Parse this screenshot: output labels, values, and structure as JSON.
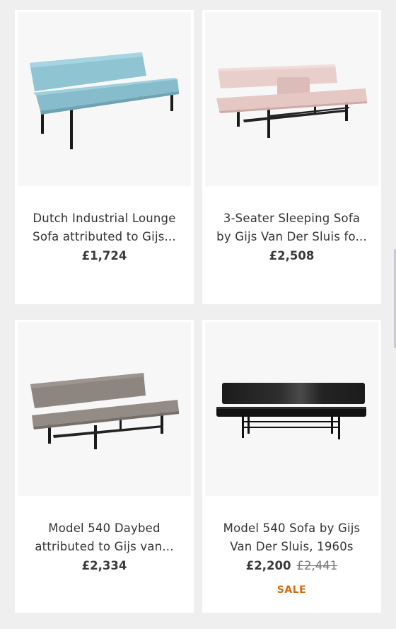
{
  "products": [
    {
      "title_line1": "Dutch Industrial Lounge",
      "title_line2": "Sofa attributed to Gijs...",
      "price": "£1,724",
      "image_icon": "blue-sofa-image"
    },
    {
      "title_line1": "3-Seater Sleeping Sofa",
      "title_line2": "by Gijs Van Der Sluis fo...",
      "price": "£2,508",
      "image_icon": "pink-sofa-image"
    },
    {
      "title_line1": "Model 540 Daybed",
      "title_line2": "attributed to Gijs van...",
      "price": "£2,334",
      "image_icon": "grey-daybed-image"
    },
    {
      "title_line1": "Model 540 Sofa by Gijs",
      "title_line2": "Van Der Sluis, 1960s",
      "price": "£2,200",
      "original_price": "£2,441",
      "badge": "SALE",
      "image_icon": "black-sofa-image"
    }
  ],
  "colors": {
    "background": "#efefef",
    "card": "#ffffff",
    "sale_badge": "#d36b12"
  }
}
